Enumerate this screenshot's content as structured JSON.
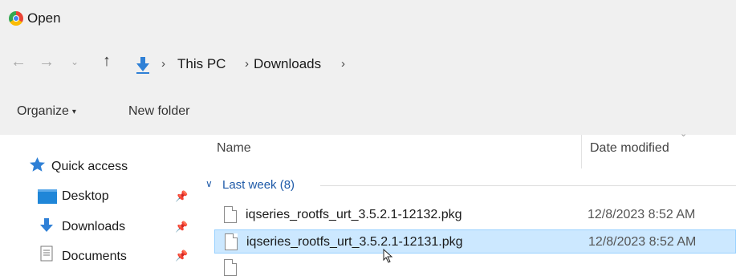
{
  "window": {
    "title": "Open",
    "app_icon": "chrome-icon"
  },
  "navigation": {
    "back_icon": "←",
    "forward_icon": "→",
    "recent_icon": "⌄",
    "up_icon": "↑",
    "separator": "›",
    "breadcrumbs": [
      "This PC",
      "Downloads"
    ]
  },
  "toolbar": {
    "organize_label": "Organize",
    "organize_caret": "▾",
    "new_folder_label": "New folder"
  },
  "sidebar": {
    "items": [
      {
        "label": "Quick access",
        "icon": "star-icon"
      },
      {
        "label": "Desktop",
        "icon": "desktop-folder-icon",
        "pinned": true
      },
      {
        "label": "Downloads",
        "icon": "download-arrow-icon",
        "pinned": true
      },
      {
        "label": "Documents",
        "icon": "documents-icon",
        "pinned": true
      }
    ],
    "pin_glyph": "📌"
  },
  "file_list": {
    "columns": {
      "name": "Name",
      "date_modified": "Date modified"
    },
    "sort_caret": "⌄",
    "group": {
      "label": "Last week (8)",
      "chevron": "∨"
    },
    "rows": [
      {
        "name": "iqseries_rootfs_urt_3.5.2.1-12132.pkg",
        "date": "12/8/2023 8:52 AM",
        "selected": false
      },
      {
        "name": "iqseries_rootfs_urt_3.5.2.1-12131.pkg",
        "date": "12/8/2023 8:52 AM",
        "selected": true
      }
    ]
  },
  "colors": {
    "accent": "#1e5aa8",
    "selection_bg": "#cce8ff",
    "selection_border": "#99d1ff",
    "chrome_bg": "#f0f0f0"
  }
}
